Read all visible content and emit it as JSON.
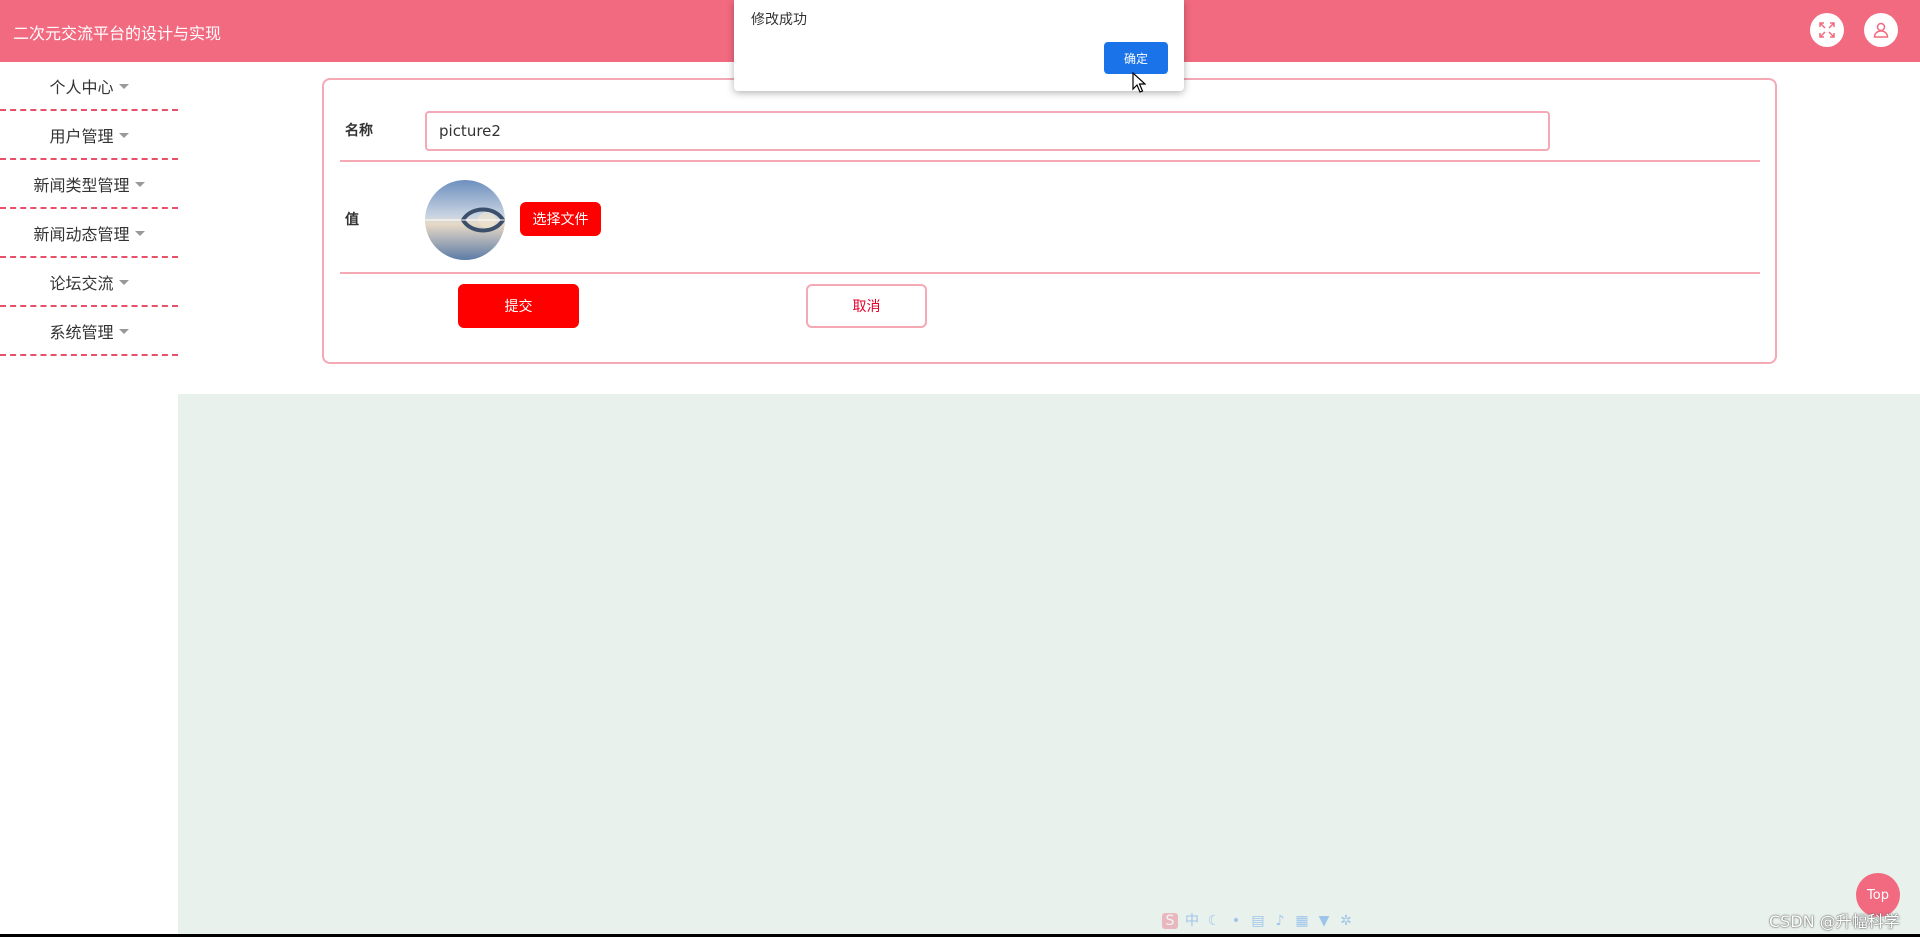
{
  "header": {
    "title": "二次元交流平台的设计与实现",
    "icons": [
      "fullscreen-icon",
      "user-icon"
    ]
  },
  "sidebar": {
    "items": [
      {
        "label": "个人中心"
      },
      {
        "label": "用户管理"
      },
      {
        "label": "新闻类型管理"
      },
      {
        "label": "新闻动态管理"
      },
      {
        "label": "论坛交流"
      },
      {
        "label": "系统管理"
      }
    ]
  },
  "form": {
    "name_label": "名称",
    "name_value": "picture2",
    "value_label": "值",
    "choose_file_label": "选择文件",
    "submit_label": "提交",
    "cancel_label": "取消"
  },
  "dialog": {
    "message": "修改成功",
    "ok_label": "确定"
  },
  "back_to_top_label": "Top",
  "watermark": "CSDN @升幅科学",
  "ime_toolbar": {
    "mode_label": "中"
  },
  "colors": {
    "header": "#f26a80",
    "accent": "#ff0000",
    "border": "#f4a9b4",
    "dialog_button": "#1a73e8",
    "content_bg": "#e8f1ec"
  }
}
